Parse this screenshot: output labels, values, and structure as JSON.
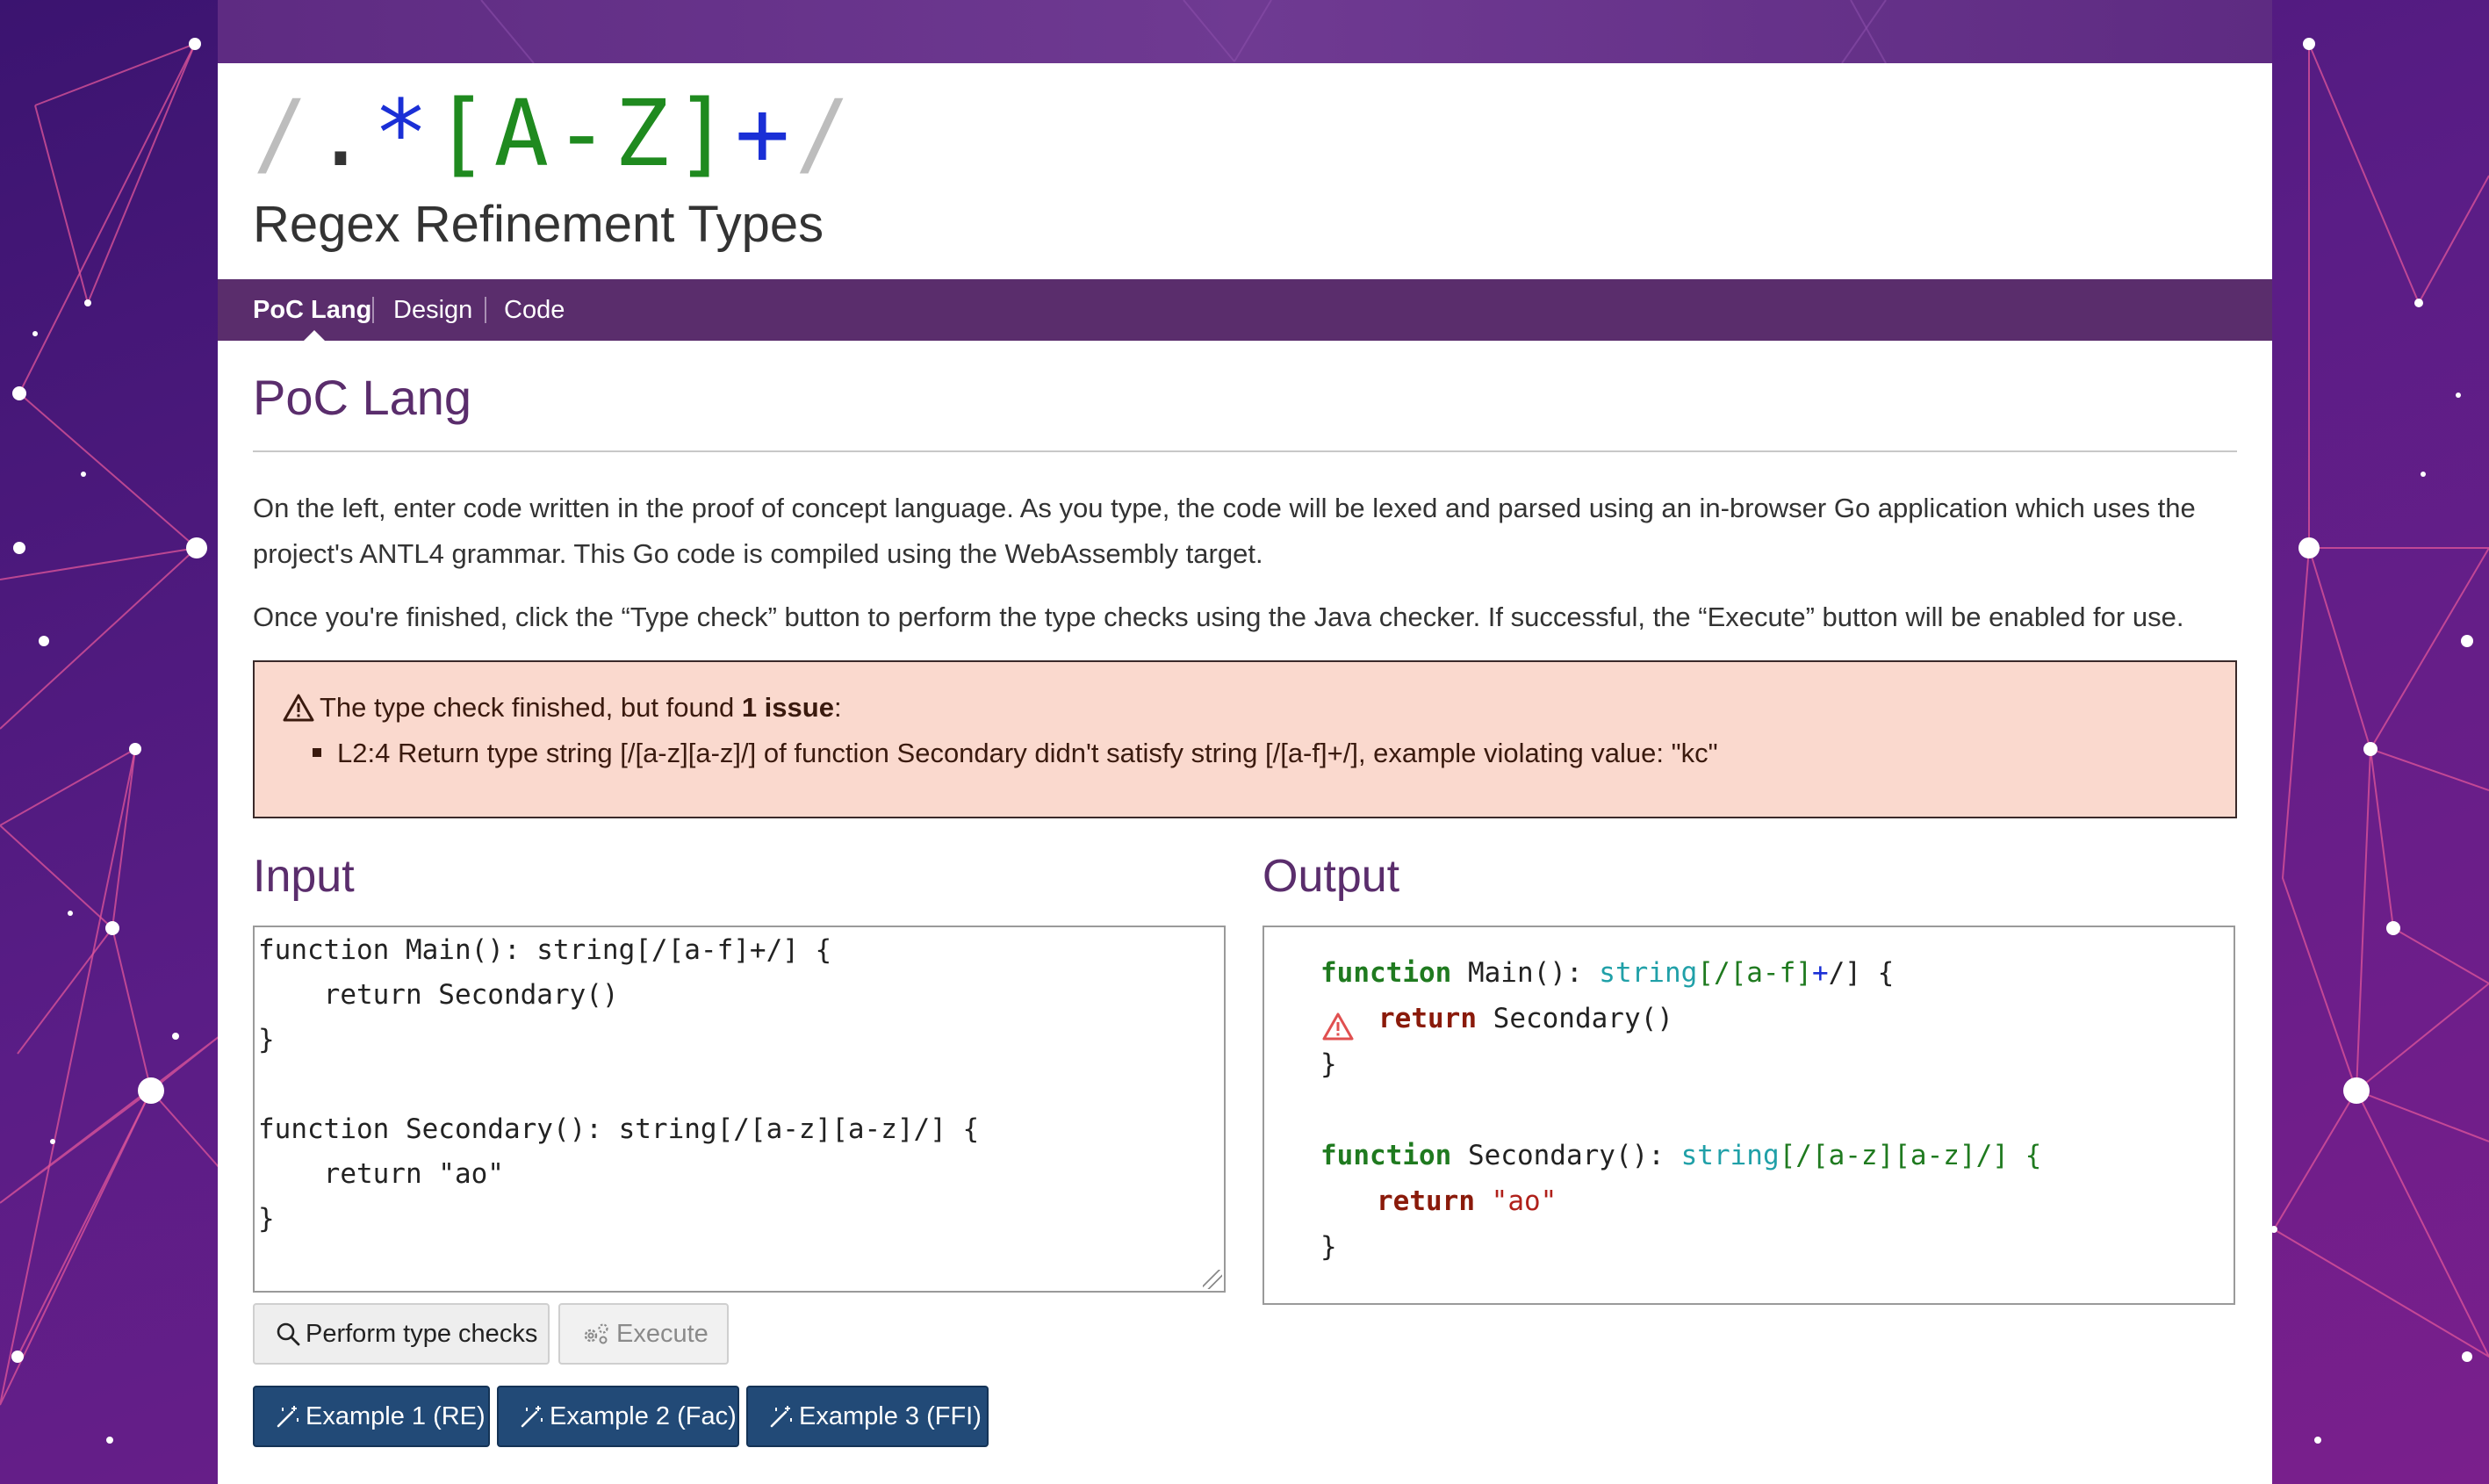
{
  "logo": {
    "slash_open": "/",
    "dot": ".",
    "star": "*",
    "char_class": "[A-Z]",
    "plus": "+",
    "slash_close": "/"
  },
  "site_subtitle": "Regex Refinement Types",
  "nav": {
    "items": [
      {
        "label": "PoC Lang",
        "active": true
      },
      {
        "label": "Design",
        "active": false
      },
      {
        "label": "Code",
        "active": false
      }
    ]
  },
  "section_title": "PoC Lang",
  "intro": {
    "p1": "On the left, enter code written in the proof of concept language. As you type, the code will be lexed and parsed using an in-browser Go application which uses the project's ANTL4 grammar. This Go code is compiled using the WebAssembly target.",
    "p2": "Once you're finished, click the “Type check” button to perform the type checks using the Java checker. If successful, the “Execute” button will be enabled for use."
  },
  "alert": {
    "head_prefix": "The type check finished, but found ",
    "issue_count": "1 issue",
    "head_suffix": ":",
    "issues": [
      "L2:4 Return type string [/[a-z][a-z]/] of function Secondary didn't satisfy string [/[a-f]+/], example violating value: \"kc\""
    ]
  },
  "input": {
    "title": "Input",
    "lines": [
      "function Main(): string[/[a-f]+/] {",
      "    return Secondary()",
      "}",
      "",
      "function Secondary(): string[/[a-z][a-z]/] {",
      "    return \"ao\"",
      "}"
    ]
  },
  "output": {
    "title": "Output",
    "kw_function": "function",
    "kw_return": "return",
    "type_string": "string",
    "main_name": "Main(): ",
    "main_regex_open": "[/[a-f]",
    "main_regex_plus": "+",
    "main_regex_close": "/] {",
    "main_body_call": "Secondary()",
    "close_brace": "}",
    "secondary_name": "Secondary(): ",
    "secondary_regex": "[/[a-z][a-z]/] {",
    "secondary_return_value": "\"ao\""
  },
  "buttons": {
    "type_check": "Perform type checks",
    "execute": "Execute",
    "example1": "Example 1 (RE)",
    "example2": "Example 2 (Fac)",
    "example3": "Example 3 (FFI)"
  },
  "colors": {
    "brand_purple": "#5a2d6c",
    "alert_bg": "#fad9ce",
    "example_button": "#224a77"
  }
}
